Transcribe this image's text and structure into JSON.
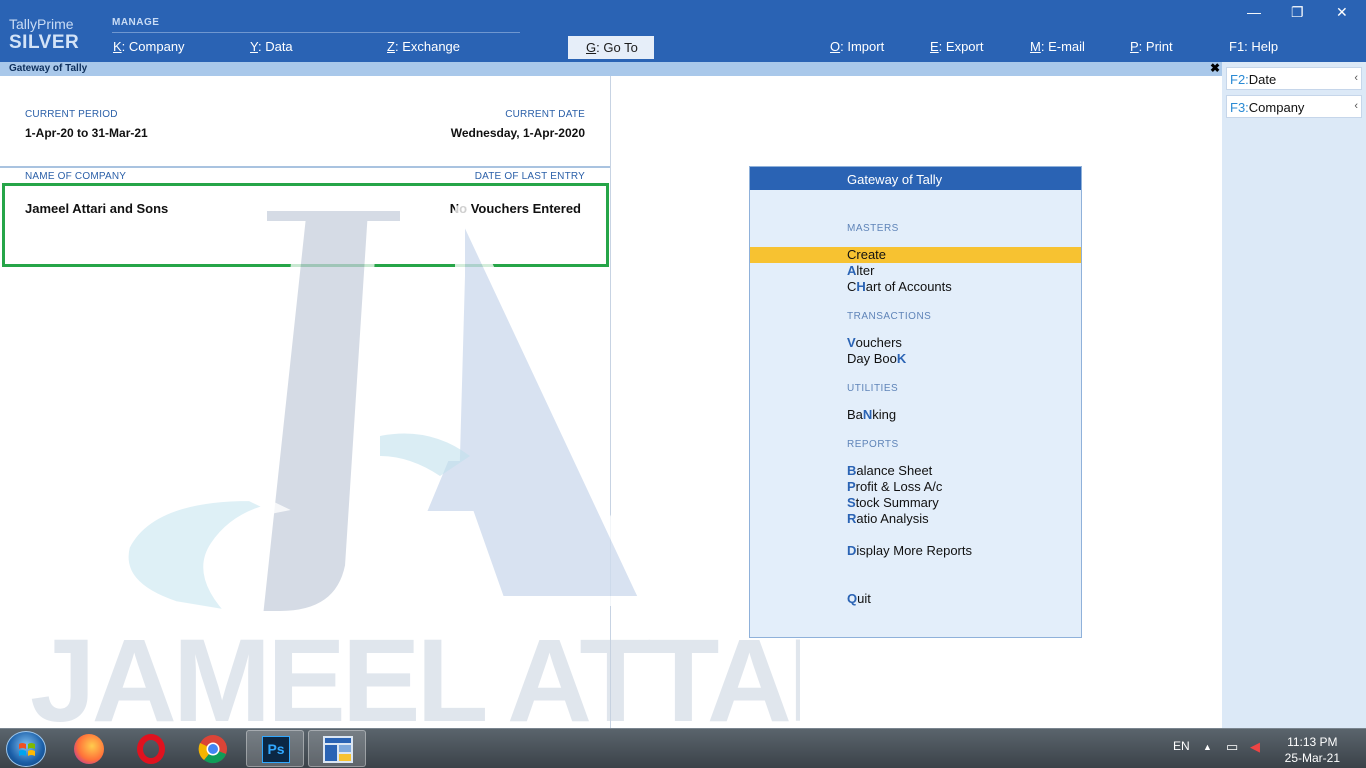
{
  "brand": {
    "product": "TallyPrime",
    "edition": "SILVER"
  },
  "menu": {
    "manage_label": "MANAGE",
    "items": [
      {
        "key": "K",
        "label": "Company"
      },
      {
        "key": "Y",
        "label": "Data"
      },
      {
        "key": "Z",
        "label": "Exchange"
      },
      {
        "key": "G",
        "label": "Go To"
      },
      {
        "key": "O",
        "label": "Import"
      },
      {
        "key": "E",
        "label": "Export"
      },
      {
        "key": "M",
        "label": "E-mail"
      },
      {
        "key": "P",
        "label": "Print"
      },
      {
        "key": "F1",
        "label": "Help"
      }
    ]
  },
  "window_controls": {
    "minimize": "—",
    "restore": "❐",
    "close": "✕"
  },
  "titlebar": {
    "title": "Gateway of Tally",
    "close": "✖"
  },
  "left": {
    "current_period_label": "CURRENT PERIOD",
    "current_period": "1-Apr-20 to 31-Mar-21",
    "current_date_label": "CURRENT DATE",
    "current_date": "Wednesday, 1-Apr-2020",
    "company_name_label": "NAME OF COMPANY",
    "last_entry_label": "DATE OF LAST ENTRY",
    "company_name": "Jameel Attari and Sons",
    "last_entry": "No Vouchers Entered"
  },
  "watermark": {
    "monogram": "JA",
    "text": "JAMEEL ATTARI"
  },
  "gateway": {
    "title": "Gateway of Tally",
    "masters_label": "MASTERS",
    "transactions_label": "TRANSACTIONS",
    "utilities_label": "UTILITIES",
    "reports_label": "REPORTS",
    "items": {
      "create": {
        "pre": "",
        "hk": "",
        "post": "Create"
      },
      "alter": {
        "pre": "",
        "hk": "A",
        "post": "lter"
      },
      "chart": {
        "pre": "C",
        "hk": "H",
        "post": "art of Accounts"
      },
      "vouchers": {
        "pre": "",
        "hk": "V",
        "post": "ouchers"
      },
      "daybook": {
        "pre": "Day Boo",
        "hk": "K",
        "post": ""
      },
      "banking": {
        "pre": "Ba",
        "hk": "N",
        "post": "king"
      },
      "balance": {
        "pre": "",
        "hk": "B",
        "post": "alance Sheet"
      },
      "pl": {
        "pre": "",
        "hk": "P",
        "post": "rofit & Loss A/c"
      },
      "stock": {
        "pre": "",
        "hk": "S",
        "post": "tock Summary"
      },
      "ratio": {
        "pre": "",
        "hk": "R",
        "post": "atio Analysis"
      },
      "more": {
        "pre": "",
        "hk": "D",
        "post": "isplay More Reports"
      },
      "quit": {
        "pre": "",
        "hk": "Q",
        "post": "uit"
      }
    }
  },
  "right_buttons": [
    {
      "key": "F2:",
      "label": "Date"
    },
    {
      "key": "F3:",
      "label": "Company"
    }
  ],
  "taskbar": {
    "language": "EN",
    "time": "11:13 PM",
    "date": "25-Mar-21",
    "apps": [
      "firefox",
      "opera",
      "chrome",
      "photoshop",
      "tally"
    ],
    "ps_label": "Ps"
  }
}
